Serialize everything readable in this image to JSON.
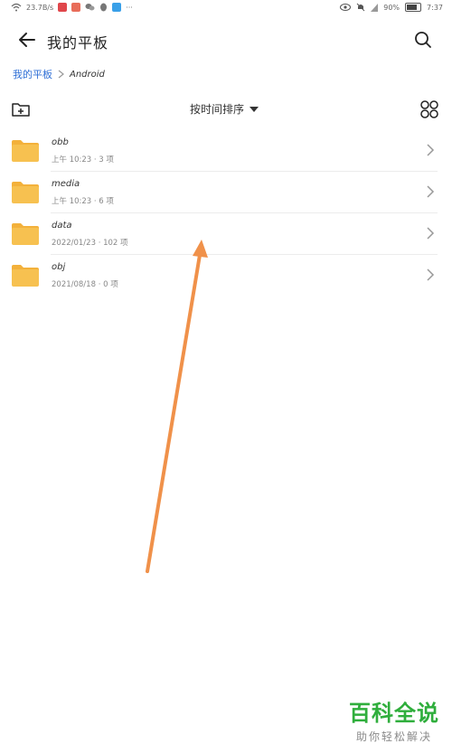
{
  "status_bar": {
    "network_speed": "23.7B/s",
    "battery_percent": "90%",
    "time": "7:37",
    "more": "···"
  },
  "header": {
    "title": "我的平板"
  },
  "breadcrumb": {
    "root": "我的平板",
    "current": "Android"
  },
  "toolbar": {
    "sort_label": "按时间排序"
  },
  "files": [
    {
      "name": "obb",
      "meta": "上午 10:23 · 3 项"
    },
    {
      "name": "media",
      "meta": "上午 10:23 · 6 项"
    },
    {
      "name": "data",
      "meta": "2022/01/23 · 102 项"
    },
    {
      "name": "obj",
      "meta": "2021/08/18 · 0 项"
    }
  ],
  "colors": {
    "folder": "#f7c150",
    "folder_tab": "#f3b13b",
    "breadcrumb_link": "#2f6fd6",
    "arrow": "#f0914a",
    "watermark": "#2fae3c"
  },
  "watermark": {
    "title": "百科全说",
    "subtitle": "助你轻松解决"
  }
}
